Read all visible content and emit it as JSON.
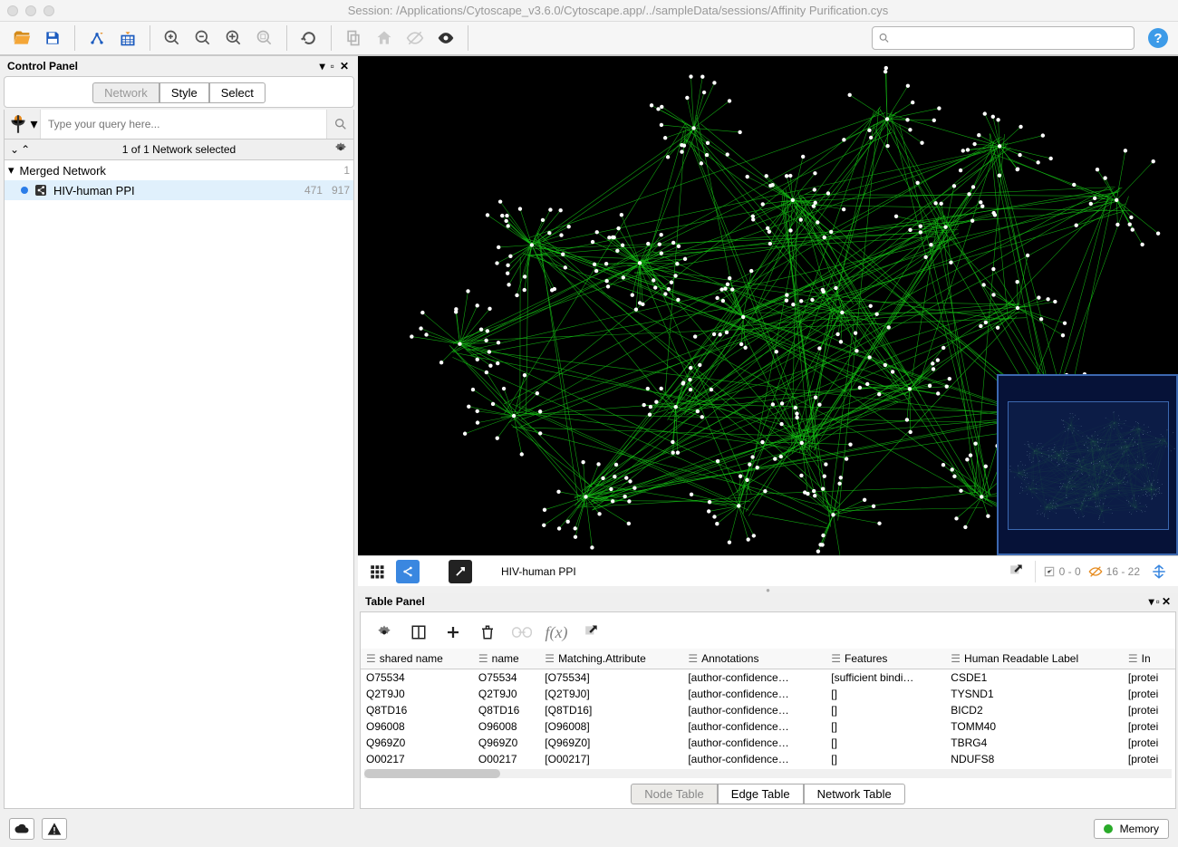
{
  "window_title": "Session: /Applications/Cytoscape_v3.6.0/Cytoscape.app/../sampleData/sessions/Affinity Purification.cys",
  "search": {
    "placeholder": ""
  },
  "control_panel": {
    "title": "Control Panel",
    "tabs": [
      "Network",
      "Style",
      "Select"
    ],
    "active_tab": 0,
    "query_placeholder": "Type your query here...",
    "status": "1 of 1 Network selected",
    "tree": {
      "root": {
        "label": "Merged Network",
        "count": "1"
      },
      "child": {
        "label": "HIV-human PPI",
        "nodes": "471",
        "edges": "917"
      }
    }
  },
  "canvas_bar": {
    "title": "HIV-human PPI",
    "sel_badge": "0 - 0",
    "hidden_badge": "16 - 22"
  },
  "table_panel": {
    "title": "Table Panel",
    "headers": [
      "shared name",
      "name",
      "Matching.Attribute",
      "Annotations",
      "Features",
      "Human Readable Label",
      "In"
    ],
    "rows": [
      [
        "O75534",
        "O75534",
        "[O75534]",
        "[author-confidence…",
        "[sufficient bindi…",
        "CSDE1",
        "[protei"
      ],
      [
        "Q2T9J0",
        "Q2T9J0",
        "[Q2T9J0]",
        "[author-confidence…",
        "[]",
        "TYSND1",
        "[protei"
      ],
      [
        "Q8TD16",
        "Q8TD16",
        "[Q8TD16]",
        "[author-confidence…",
        "[]",
        "BICD2",
        "[protei"
      ],
      [
        "O96008",
        "O96008",
        "[O96008]",
        "[author-confidence…",
        "[]",
        "TOMM40",
        "[protei"
      ],
      [
        "Q969Z0",
        "Q969Z0",
        "[Q969Z0]",
        "[author-confidence…",
        "[]",
        "TBRG4",
        "[protei"
      ],
      [
        "O00217",
        "O00217",
        "[O00217]",
        "[author-confidence…",
        "[]",
        "NDUFS8",
        "[protei"
      ]
    ],
    "tabs": [
      "Node Table",
      "Edge Table",
      "Network Table"
    ],
    "active_tab": 0
  },
  "memory_label": "Memory"
}
